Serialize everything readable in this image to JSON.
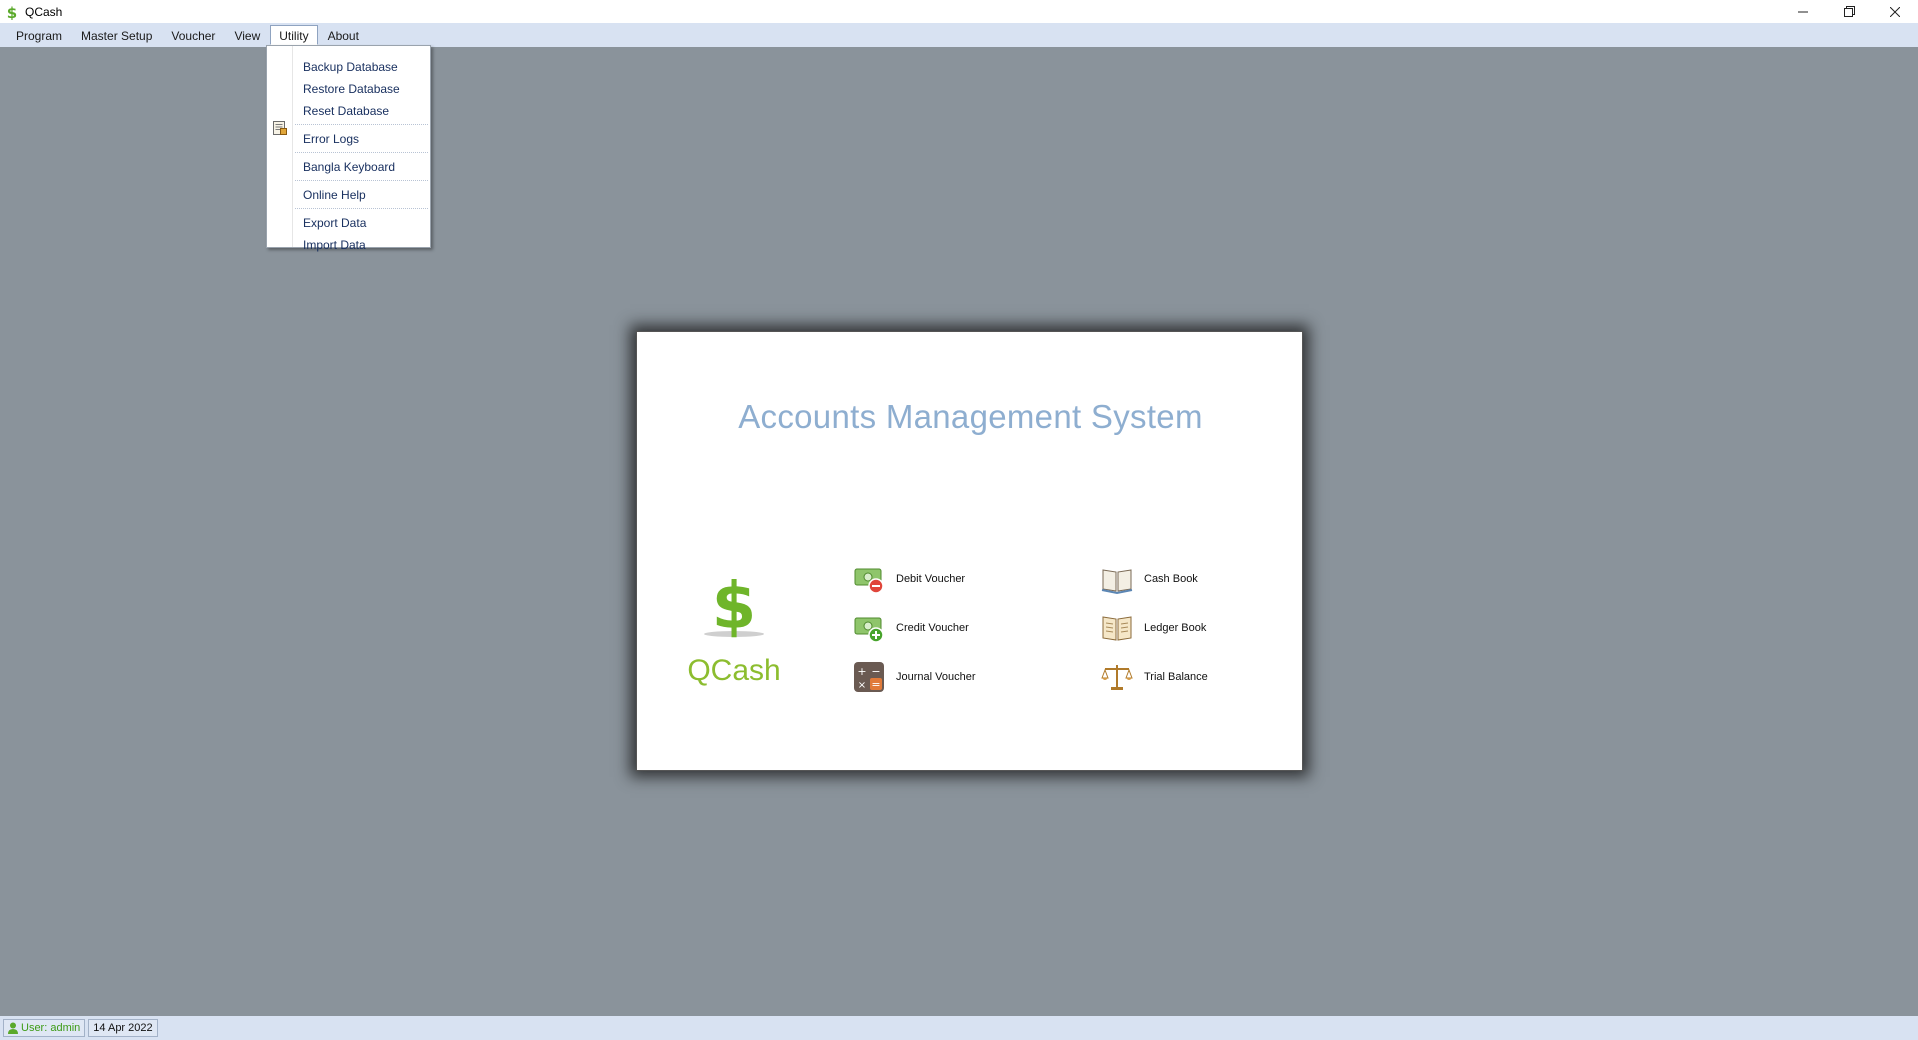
{
  "window": {
    "title": "QCash",
    "icon": "dollar-icon",
    "controls": [
      "minimize-icon",
      "restore-icon",
      "close-icon"
    ]
  },
  "menubar": {
    "items": [
      "Program",
      "Master Setup",
      "Voucher",
      "View",
      "Utility",
      "About"
    ],
    "open_item": "Utility"
  },
  "utility_menu": {
    "items": [
      {
        "label": "Backup Database"
      },
      {
        "label": "Restore Database"
      },
      {
        "label": "Reset Database"
      },
      {
        "label": "Error Logs",
        "icon": "log-report-icon"
      },
      {
        "label": "Bangla Keyboard"
      },
      {
        "label": "Online Help"
      },
      {
        "label": "Export Data"
      },
      {
        "label": "Import Data"
      }
    ]
  },
  "welcome": {
    "title": "Accounts Management System",
    "logo_text": "QCash",
    "logo_color": "#8cbd2f",
    "title_color": "#8eaed0",
    "shortcuts": [
      {
        "label": "Debit Voucher",
        "icon": "debit-voucher-icon"
      },
      {
        "label": "Credit Voucher",
        "icon": "credit-voucher-icon"
      },
      {
        "label": "Journal Voucher",
        "icon": "calculator-icon"
      },
      {
        "label": "Cash Book",
        "icon": "open-book-icon"
      },
      {
        "label": "Ledger Book",
        "icon": "ledger-book-icon"
      },
      {
        "label": "Trial Balance",
        "icon": "scales-icon"
      }
    ]
  },
  "statusbar": {
    "user": "User: admin",
    "date": "14 Apr 2022"
  },
  "colors": {
    "workspace": "#8a939b",
    "menubar": "#d8e2f2",
    "menu_text": "#1a3160"
  }
}
